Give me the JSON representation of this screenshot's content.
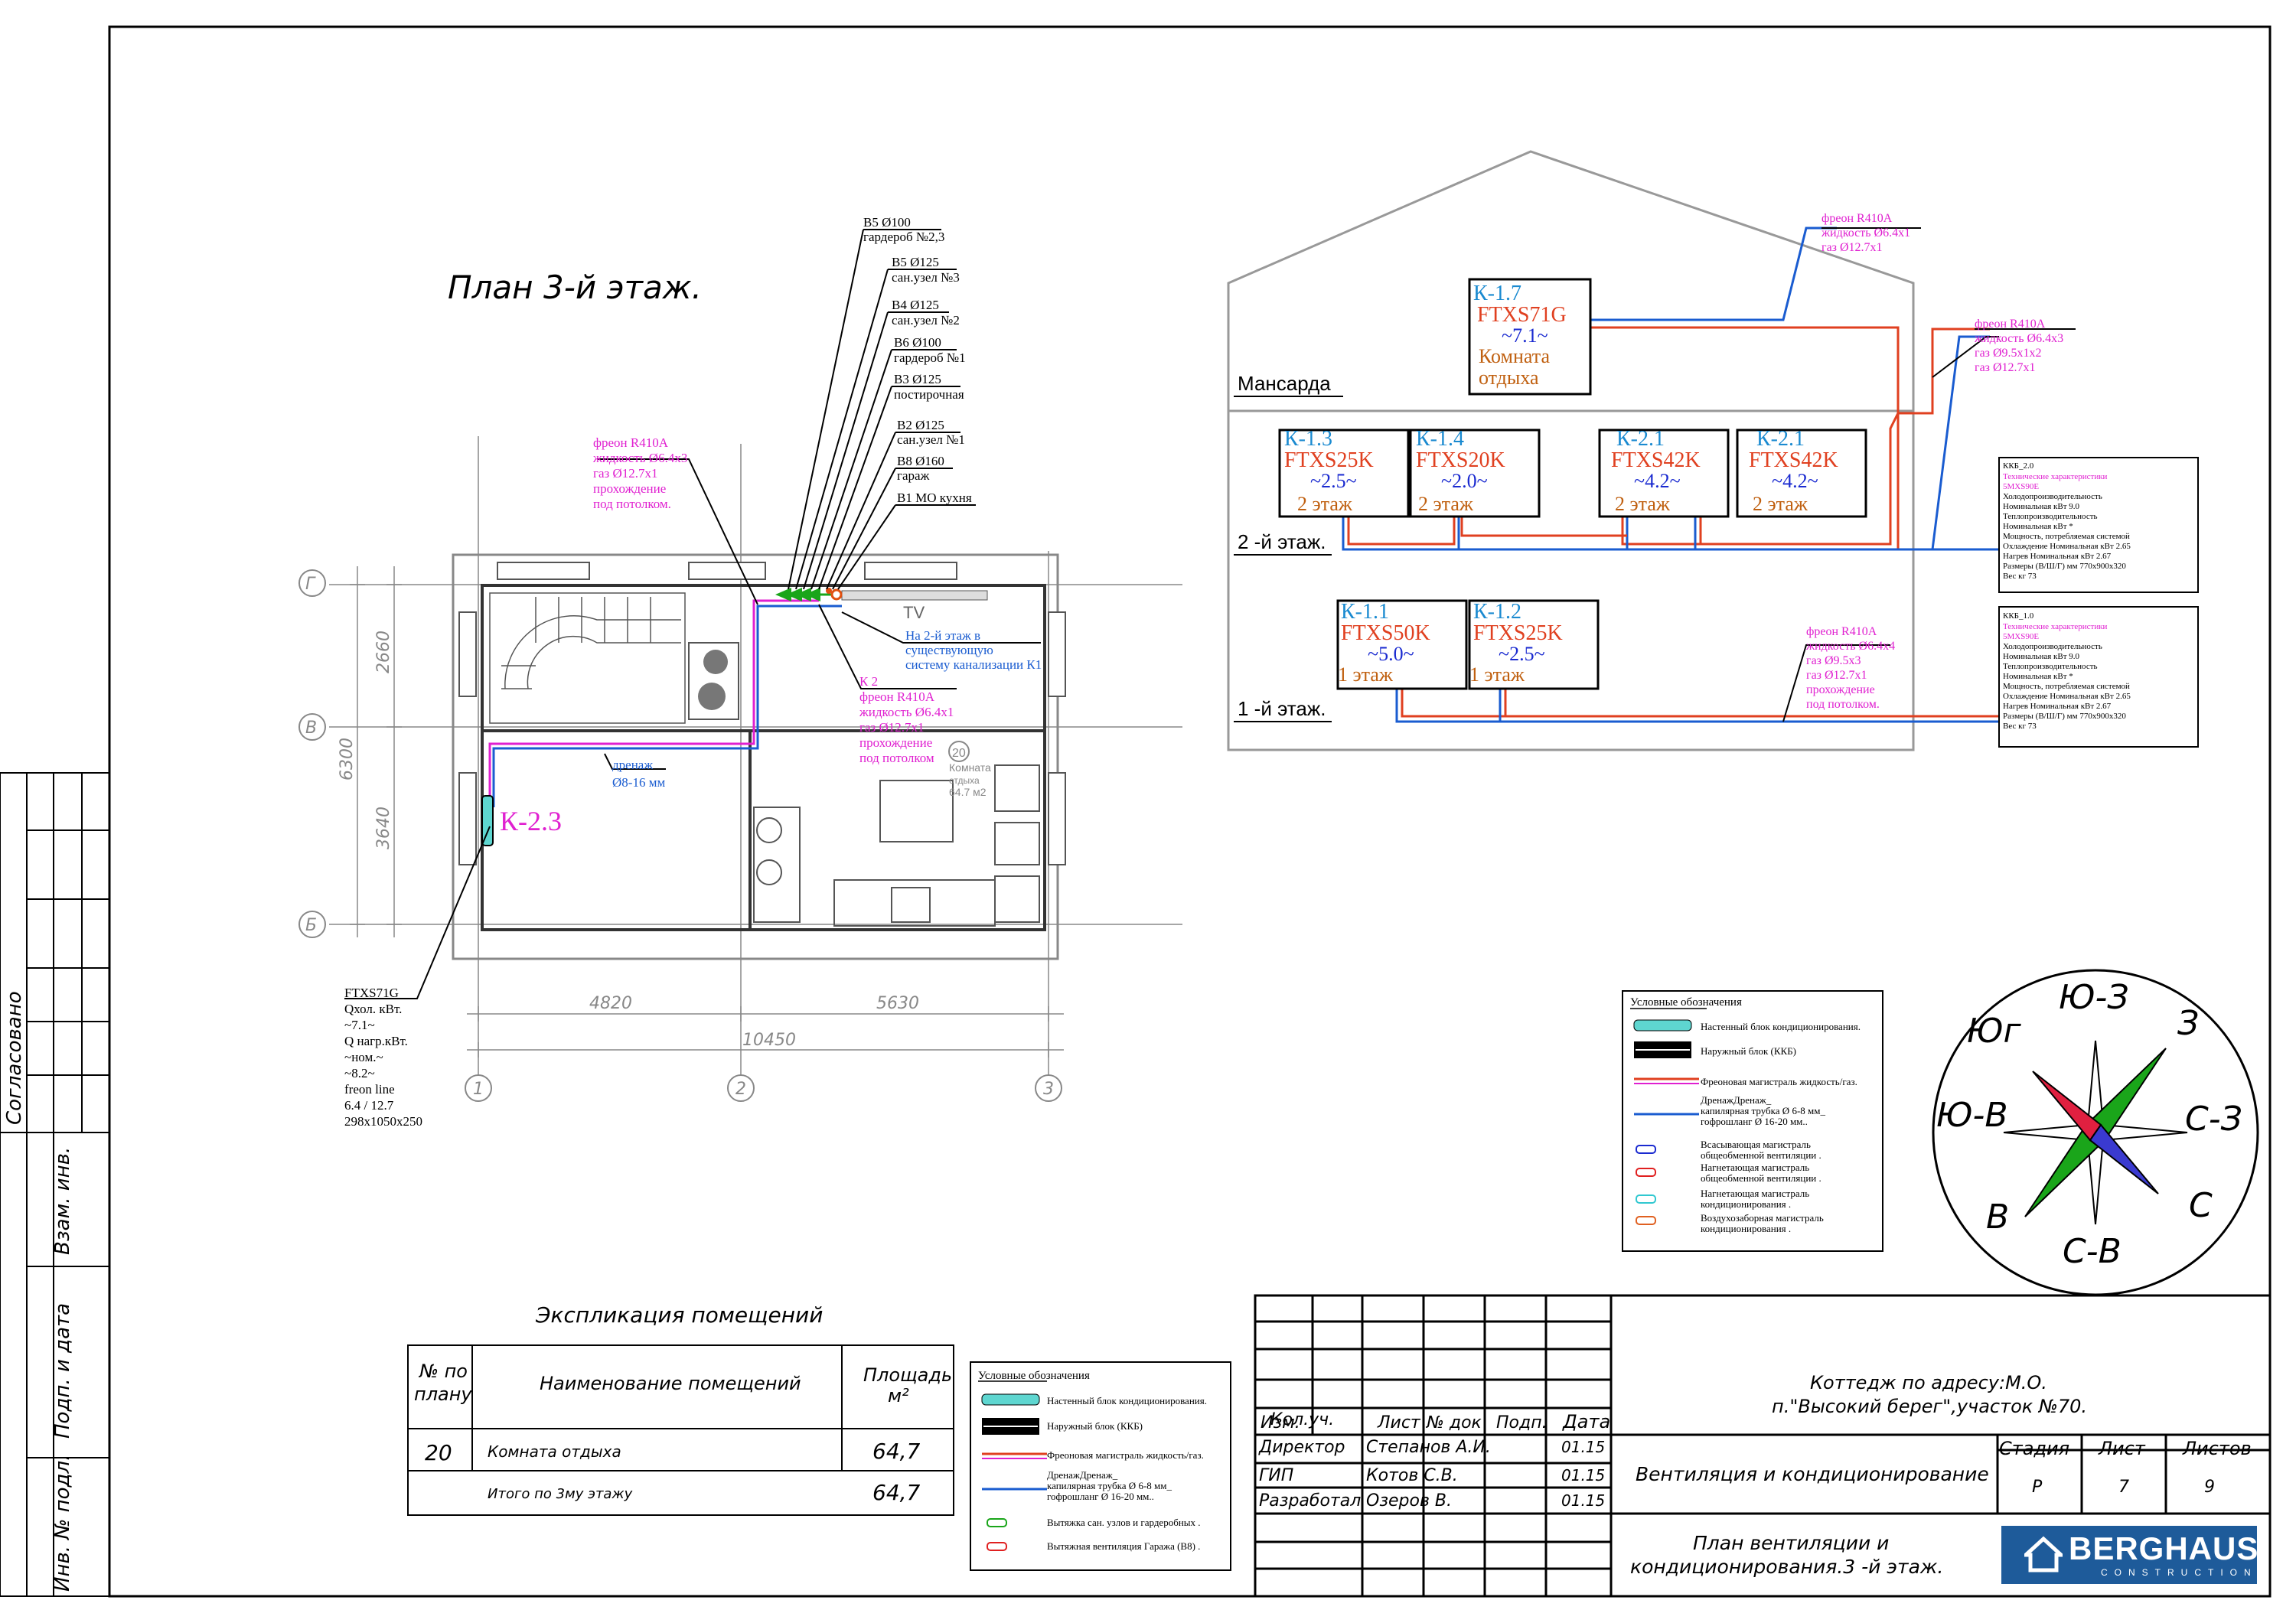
{
  "plan_title": "План 3-й этаж.",
  "left_margin": {
    "agreed": "Согласовано",
    "inv_replace": "Взам. инв.",
    "sign_date": "Подп. и дата",
    "inv_orig": "Инв. № подл."
  },
  "ventilation_labels": [
    {
      "line1": "В5  Ø100",
      "line2": "гардероб №2,3"
    },
    {
      "line1": "В5  Ø125",
      "line2": "сан.узел №3"
    },
    {
      "line1": "В4  Ø125",
      "line2": "сан.узел №2"
    },
    {
      "line1": "В6  Ø100",
      "line2": "гардероб №1"
    },
    {
      "line1": "В3    Ø125",
      "line2": "постирочная"
    },
    {
      "line1": "В2  Ø125",
      "line2": "сан.узел №1"
    },
    {
      "line1": "В8  Ø160",
      "line2": "гараж"
    },
    {
      "line1": "В1  МО  кухня",
      "line2": ""
    }
  ],
  "freon_note_top": [
    "фреон R410A",
    "жидкость  Ø6.4x3",
    "газ  Ø12.7x1",
    "прохождение",
    "под потолком."
  ],
  "sewer_note": [
    "На 2-й этаж в",
    "существующую",
    "систему канализации К1"
  ],
  "k2_note": [
    "К 2",
    "фреон R410A",
    "жидкость  Ø6.4x1",
    "газ  Ø12.7x1",
    "прохождение",
    "под потолком"
  ],
  "drain_note": [
    "дренаж",
    "Ø8-16 мм"
  ],
  "unit_label": "К-2.3",
  "tv_label": "TV",
  "room_tag": {
    "num": "20",
    "name": "Комната",
    "name2": "отдыха",
    "area": "64.7 м2"
  },
  "unit_spec": [
    "FTXS71G",
    "Qхол. кВт.",
    "~7.1~",
    "Q нагр.кВт.",
    "~ном.~",
    "~8.2~",
    "freon line",
    "6.4 / 12.7",
    "298x1050x250"
  ],
  "axes": {
    "rows": [
      "Г",
      "В",
      "Б"
    ],
    "cols": [
      "1",
      "2",
      "3"
    ]
  },
  "dims": {
    "d1": "2660",
    "d2": "3640",
    "total_v": "6300",
    "h1": "4820",
    "h2": "5630",
    "total_h": "10450"
  },
  "schematic": {
    "floors": {
      "attic": "Мансарда",
      "second": "2 -й этаж.",
      "first": "1 -й этаж."
    },
    "units": [
      {
        "id": "К-1.7",
        "model": "FTXS71G",
        "power": "~7.1~",
        "place": "Комната",
        "place2": "отдыха"
      },
      {
        "id": "К-1.3",
        "model": "FTXS25K",
        "power": "~2.5~",
        "place": "2 этаж"
      },
      {
        "id": "К-1.4",
        "model": "FTXS20K",
        "power": "~2.0~",
        "place": "2 этаж"
      },
      {
        "id": "К-2.1",
        "model": "FTXS42K",
        "power": "~4.2~",
        "place": "2 этаж"
      },
      {
        "id": "К-2.1",
        "model": "FTXS42K",
        "power": "~4.2~",
        "place": "2 этаж"
      },
      {
        "id": "К-1.1",
        "model": "FTXS50K",
        "power": "~5.0~",
        "place": "1 этаж"
      },
      {
        "id": "К-1.2",
        "model": "FTXS25K",
        "power": "~2.5~",
        "place": "1 этаж"
      }
    ],
    "notes": {
      "n1": [
        "фреон R410A",
        "жидкость  Ø6.4x1",
        "газ  Ø12.7x1"
      ],
      "n2": [
        "фреон R410A",
        "жидкость  Ø6.4x3",
        "газ  Ø9.5x1x2",
        "газ  Ø12.7x1"
      ],
      "n3": [
        "фреон R410A",
        "жидкость  Ø6.4x4",
        "газ  Ø9.5x3",
        "газ  Ø12.7x1",
        "прохождение",
        "под потолком."
      ]
    },
    "outdoor": [
      {
        "id": "ККБ_2.0",
        "rows": [
          "Технические характеристики",
          "5MXS90E",
          "Холодопроизводительность",
          "Номинальная      кВт   9.0",
          "Теплопроизводительность",
          "Номинальная      кВт   *",
          "Мощность, потребляемая системой",
          "Охлаждение       Номинальная      кВт   2.65",
          "Нагрев              Номинальная      кВт   2.67",
          "Размеры    (В/Ш/Г)     мм    770x900x320",
          "Вес    кг     73"
        ]
      },
      {
        "id": "ККБ_1.0",
        "rows": [
          "Технические характеристики",
          "5MXS90E",
          "Холодопроизводительность",
          "Номинальная      кВт   9.0",
          "Теплопроизводительность",
          "Номинальная      кВт   *",
          "Мощность, потребляемая системой",
          "Охлаждение       Номинальная      кВт   2.65",
          "Нагрев              Номинальная      кВт   2.67",
          "Размеры    (В/Ш/Г)     мм    770x900x320",
          "Вес    кг     73"
        ]
      }
    ]
  },
  "legend_right": {
    "title": "Условные обозначения",
    "items": [
      "Настенный блок кондиционирования.",
      "Наружный блок (ККБ)",
      "Фреоновая магистраль  жидкость/газ.",
      "ДренажДренаж_",
      "капилярная трубка  Ø 6-8 мм_",
      "гофрошланг  Ø 16-20 мм..",
      "Всасывающая магистраль",
      "общеобменной вентиляции .",
      "Нагнетающая  магистраль",
      "общеобменной вентиляции .",
      "Нагнетающая магистраль",
      "кондиционирования .",
      "Воздухозаборная магистраль",
      "кондиционирования ."
    ]
  },
  "legend_bottom": {
    "title": "Условные обозначения",
    "items": [
      "Настенный блок кондиционирования.",
      "Наружный блок (ККБ)",
      "Фреоновая магистраль  жидкость/газ.",
      "ДренажДренаж_",
      "капилярная трубка  Ø 6-8 мм_",
      "гофрошланг  Ø 16-20 мм..",
      "Вытяжка сан. узлов и гардеробных .",
      "Вытяжная вентиляция Гаража (В8) ."
    ]
  },
  "compass": {
    "n": "Ю-З",
    "ne": "З",
    "e": "С-З",
    "se": "С",
    "s": "С-В",
    "sw": "В",
    "w": "Ю-В",
    "nw": "Юг"
  },
  "explication": {
    "title": "Экспликация помещений",
    "headers": [
      "№ по",
      "плану",
      "Наименование помещений",
      "Площадь",
      "м²"
    ],
    "rows": [
      {
        "num": "20",
        "name": "Комната отдыха",
        "area": "64,7"
      }
    ],
    "total": {
      "name": "Итого по 3му этажу",
      "area": "64,7"
    }
  },
  "title_block": {
    "address1": "Коттедж по адресу:М.О.",
    "address2": "п.\"Высокий берег\",участок №70.",
    "col_headers": [
      "Изм.",
      "Кол.уч.",
      "Лист",
      "№ док",
      "Подп.",
      "Дата"
    ],
    "people": [
      {
        "role": "Директор",
        "name": "Степанов А.И.",
        "date": "01.15"
      },
      {
        "role": "ГИП",
        "name": "Котов  С.В.",
        "date": "01.15"
      },
      {
        "role": "Разработал",
        "name": "Озеров В.",
        "date": "01.15"
      }
    ],
    "section": "Вентиляция и кондиционирование",
    "stage_h": "Стадия",
    "sheet_h": "Лист",
    "sheets_h": "Листов",
    "stage": "Р",
    "sheet": "7",
    "sheets": "9",
    "drawing1": "План вентиляции и",
    "drawing2": "кондиционирования.3 -й этаж.",
    "logo": "BERGHAUS",
    "logo_sub": "CONSTRUCTION"
  }
}
